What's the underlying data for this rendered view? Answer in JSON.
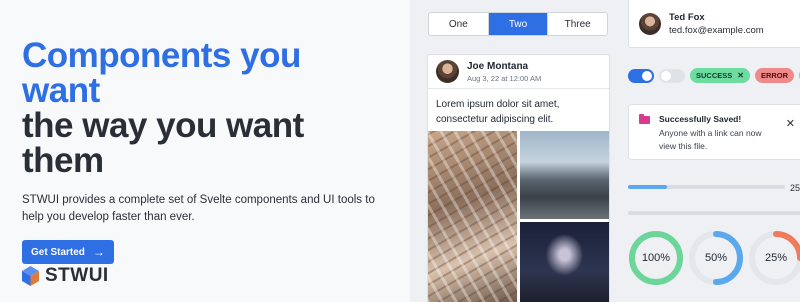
{
  "hero": {
    "title_line1": "Components you",
    "title_line2": "want",
    "title_line3": "the way you want",
    "title_line4": "them",
    "description": "STWUI provides a complete set of Svelte components and UI tools to help you develop faster than ever.",
    "cta_label": "Get Started",
    "cta_icon": "arrow-right-icon",
    "logo_text": "STWUI"
  },
  "segmented": {
    "options": [
      "One",
      "Two",
      "Three"
    ],
    "selected": "Two"
  },
  "post_card": {
    "author": "Joe Montana",
    "date": "Aug 3, 22 at 12:00 AM",
    "body": "Lorem ipsum dolor sit amet, consectetur adipiscing elit."
  },
  "contact": {
    "name": "Ted Fox",
    "email": "ted.fox@example.com"
  },
  "toggles": [
    {
      "state": "on"
    },
    {
      "state": "off"
    }
  ],
  "badges": [
    {
      "label": "SUCCESS",
      "variant": "success",
      "dismissible": true
    },
    {
      "label": "ERROR",
      "variant": "error"
    },
    {
      "label": "IN",
      "variant": "info"
    }
  ],
  "toast": {
    "title": "Successfully Saved!",
    "message": "Anyone with a link can now view this file.",
    "icon": "folder-icon"
  },
  "progress": [
    {
      "value": 0.25,
      "label": "25"
    },
    {
      "value": 0.0
    }
  ],
  "rings": [
    {
      "label": "100%",
      "value": 100,
      "color": "#6bd59a"
    },
    {
      "label": "50%",
      "value": 50,
      "color": "#5aa9ef"
    },
    {
      "label": "25%",
      "value": 25,
      "color": "#ef7a5c"
    }
  ],
  "colors": {
    "accent": "#2f6fe4",
    "text": "#2a2f37"
  }
}
